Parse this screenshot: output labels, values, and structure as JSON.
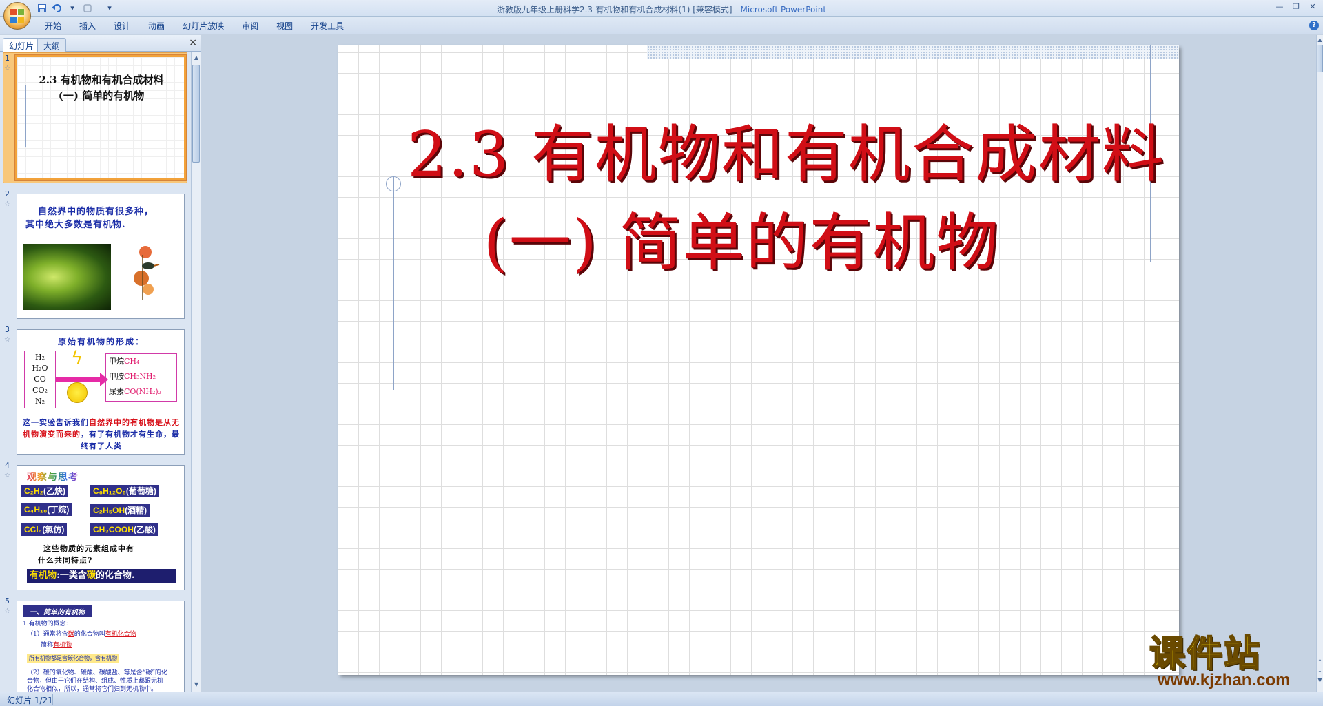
{
  "window": {
    "title": "浙教版九年级上册科学2.3-有机物和有机合成材料(1) [兼容模式]",
    "app_name": "Microsoft PowerPoint",
    "title_separator": " - "
  },
  "ribbon": {
    "tabs": [
      "开始",
      "插入",
      "设计",
      "动画",
      "幻灯片放映",
      "审阅",
      "视图",
      "开发工具"
    ]
  },
  "left_pane": {
    "tab_slides": "幻灯片",
    "tab_outline": "大纲",
    "close": "×",
    "thumbnails": [
      {
        "num": "1",
        "title_line1": "2.3 有机物和有机合成材料",
        "title_line2": "(一) 简单的有机物"
      },
      {
        "num": "2",
        "text_line1": "自然界中的物质有很多种，",
        "text_line2": "其中绝大多数是有机物."
      },
      {
        "num": "3",
        "title": "原始有机物的形成：",
        "reactants": [
          "H₂",
          "H₂O",
          "CO",
          "CO₂",
          "N₂"
        ],
        "products": [
          {
            "name": "甲烷",
            "formula": "CH₄"
          },
          {
            "name": "甲胺",
            "formula": "CH₃NH₂"
          },
          {
            "name": "尿素",
            "formula": "CO(NH₂)₂"
          }
        ],
        "caption_a": "这一实验告诉我们",
        "caption_b": "自然界中的",
        "caption_c": "有机物是从无机物演变而来的",
        "caption_d": "，有了有机物才有生命，最终有了人类"
      },
      {
        "num": "4",
        "title": "观察与思考",
        "chips": [
          {
            "formula": "C₂H₂",
            "name": "(乙炔)"
          },
          {
            "formula": "C₆H₁₂O₆",
            "name": "(葡萄糖)"
          },
          {
            "formula": "C₄H₁₀",
            "name": "(丁烷)"
          },
          {
            "formula": "C₂H₅OH",
            "name": "(酒精)"
          },
          {
            "formula": "CCl₄",
            "name": "(氯仿)"
          },
          {
            "formula": "CH₃COOH",
            "name": "(乙酸)"
          }
        ],
        "question_line1": "这些物质的元素组成中有",
        "question_line2": "什么共同特点?",
        "def_a": "有机物",
        "def_b": ":一类含",
        "def_c": "碳",
        "def_d": "的化合物."
      },
      {
        "num": "5",
        "heading": "一、简单的有机物",
        "line1": "1.有机物的概念:",
        "line2a": "（1）通常将含",
        "line2b": "碳",
        "line2c": "的化合物叫",
        "line2d": "有机化合物",
        "line3a": "简称",
        "line3b": "有机物",
        "highlight": "所有机物都是含碳化合物，含有机物",
        "line4": "（2）碳的氧化物、碳酸、碳酸盐、等是含“碳”的化",
        "line5": "合物，但由于它们在结构、组成、性质上都跟无机",
        "line6": "化合物相似，所以，通常将它们归到无机物中。"
      }
    ]
  },
  "slide": {
    "title_line1": "2.3 有机物和有机合成材料",
    "title_line2": "(一) 简单的有机物"
  },
  "watermark": {
    "text": "课件站",
    "url": "www.kjzhan.com"
  },
  "status": {
    "slide_indicator": "幻灯片 1/21"
  },
  "colors": {
    "title_red": "#d10e16",
    "ribbon_text": "#15428b",
    "selection_orange": "#f2a23a"
  }
}
